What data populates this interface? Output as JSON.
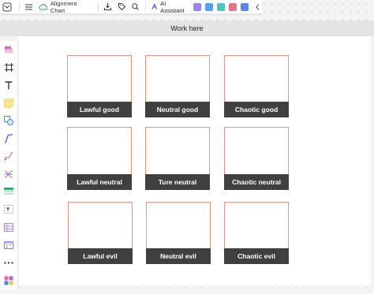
{
  "toolbar": {
    "doc_title": "Alignment Chart",
    "ai_label": "AI Assistant",
    "mini_icons": [
      {
        "name": "magic-icon",
        "color": "#8a6ff0"
      },
      {
        "name": "presentation-icon",
        "color": "#3b8df2"
      },
      {
        "name": "share-icon",
        "color": "#2fb8b0"
      },
      {
        "name": "image-gen-icon",
        "color": "#e05a6f"
      },
      {
        "name": "chat-icon",
        "color": "#3f6fe6"
      }
    ]
  },
  "banner": {
    "text": "Work here"
  },
  "sidebar": {
    "items": [
      {
        "name": "templates-icon"
      },
      {
        "name": "frame-icon"
      },
      {
        "name": "text-icon"
      },
      {
        "name": "sticky-note-icon"
      },
      {
        "name": "shapes-icon"
      },
      {
        "name": "connector-icon"
      },
      {
        "name": "pen-icon"
      },
      {
        "name": "mind-map-icon"
      },
      {
        "name": "table-icon"
      },
      {
        "name": "text-box-icon"
      },
      {
        "name": "grid-icon"
      },
      {
        "name": "calendar-icon"
      },
      {
        "name": "more-icon"
      },
      {
        "name": "apps-icon"
      }
    ]
  },
  "cards": [
    {
      "label": "Lawful good"
    },
    {
      "label": "Neutral good"
    },
    {
      "label": "Chaotic good"
    },
    {
      "label": "Lawful neutral"
    },
    {
      "label": "Ture neutral"
    },
    {
      "label": "Chaotic neutral"
    },
    {
      "label": "Lawful evil"
    },
    {
      "label": "Neutral evil"
    },
    {
      "label": "Chaotic evil"
    }
  ],
  "colors": {
    "card_border": "#ee8f80",
    "label_bg": "#404040",
    "banner_bg": "#e4e4e6"
  }
}
